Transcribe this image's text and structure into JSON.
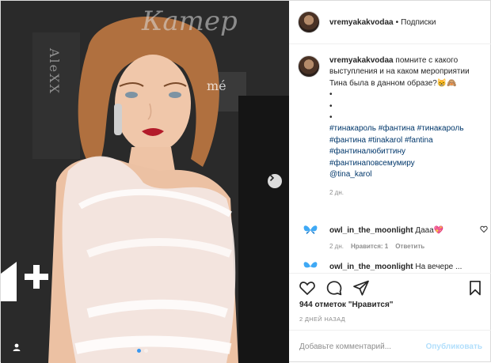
{
  "header": {
    "username": "vremyakakvodaa",
    "separator": "•",
    "follow_label": "Подписки"
  },
  "post": {
    "username": "vremyakakvodaa",
    "caption": "помните с какого выступления и на каком мероприятии Тина была в данном образе?",
    "emoji": "😸🙈",
    "bullets": [
      "•",
      "•",
      "•"
    ],
    "hashtags_line1": [
      "#тинакароль",
      "#фантина",
      "#тинакароль"
    ],
    "hashtags_line2": [
      "#фантина",
      "#tinakarol",
      "#fantina"
    ],
    "hashtags_line3": [
      "#фантиналюбиттину"
    ],
    "hashtags_line4": [
      "#фантинаповсемумиру"
    ],
    "mention": "@tina_karol",
    "time": "2 дн."
  },
  "comments": [
    {
      "username": "owl_in_the_moonlight",
      "text": "Дааа💖",
      "time": "2 дн.",
      "likes_label": "Нравится: 1",
      "reply_label": "Ответить"
    },
    {
      "username": "owl_in_the_moonlight",
      "text": "На вечере ..."
    }
  ],
  "actions": {
    "likes": "944 отметок \"Нравится\"",
    "date": "2 ДНЕЙ НАЗАД",
    "comment_placeholder": "Добавьте комментарий...",
    "post_button": "Опубликовать"
  },
  "photo": {
    "background_text_top": "Катер",
    "background_text_left": "AleXX",
    "background_text_brand": "mé",
    "slide_count": 2,
    "active_slide": 1
  },
  "colors": {
    "link": "#00376b",
    "accent": "#3897f0",
    "muted": "#8e8e8e",
    "post_disabled": "#b2dffc",
    "heart": "#e0245e"
  },
  "icons": [
    "heart-icon",
    "comment-icon",
    "share-icon",
    "bookmark-icon",
    "arrow-right-icon",
    "user-tag-icon",
    "butterfly-icon"
  ]
}
